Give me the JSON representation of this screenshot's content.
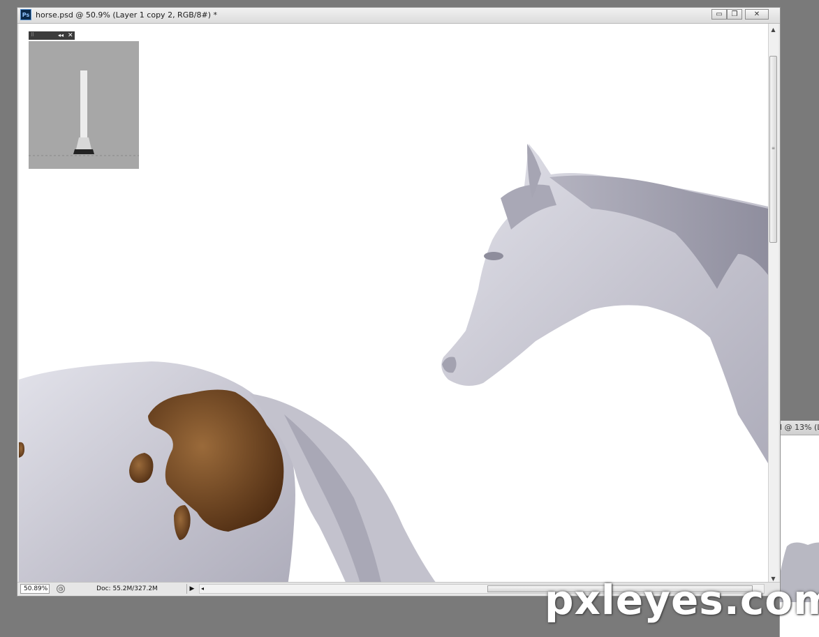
{
  "window": {
    "app_icon_text": "Ps",
    "title": "horse.psd @ 50.9% (Layer 1 copy 2, RGB/8#) *",
    "buttons": {
      "minimize": "▭",
      "restore": "❐",
      "close": "✕"
    }
  },
  "background_window": {
    "title": "l @ 13% (L"
  },
  "status_bar": {
    "zoom": "50.89%",
    "doc_info": "Doc: 55.2M/327.2M",
    "play_icon": "▶",
    "scroll_left_icon": "◂"
  },
  "floating_panel": {
    "grip_icon": "⠿",
    "collapse_icon": "◂◂",
    "close_icon": "✕"
  },
  "watermark": "pxleyes.com",
  "colors": {
    "horse_body": "#c9c8d2",
    "horse_spot": "#6a3f1e",
    "canvas_bg": "#ffffff"
  }
}
